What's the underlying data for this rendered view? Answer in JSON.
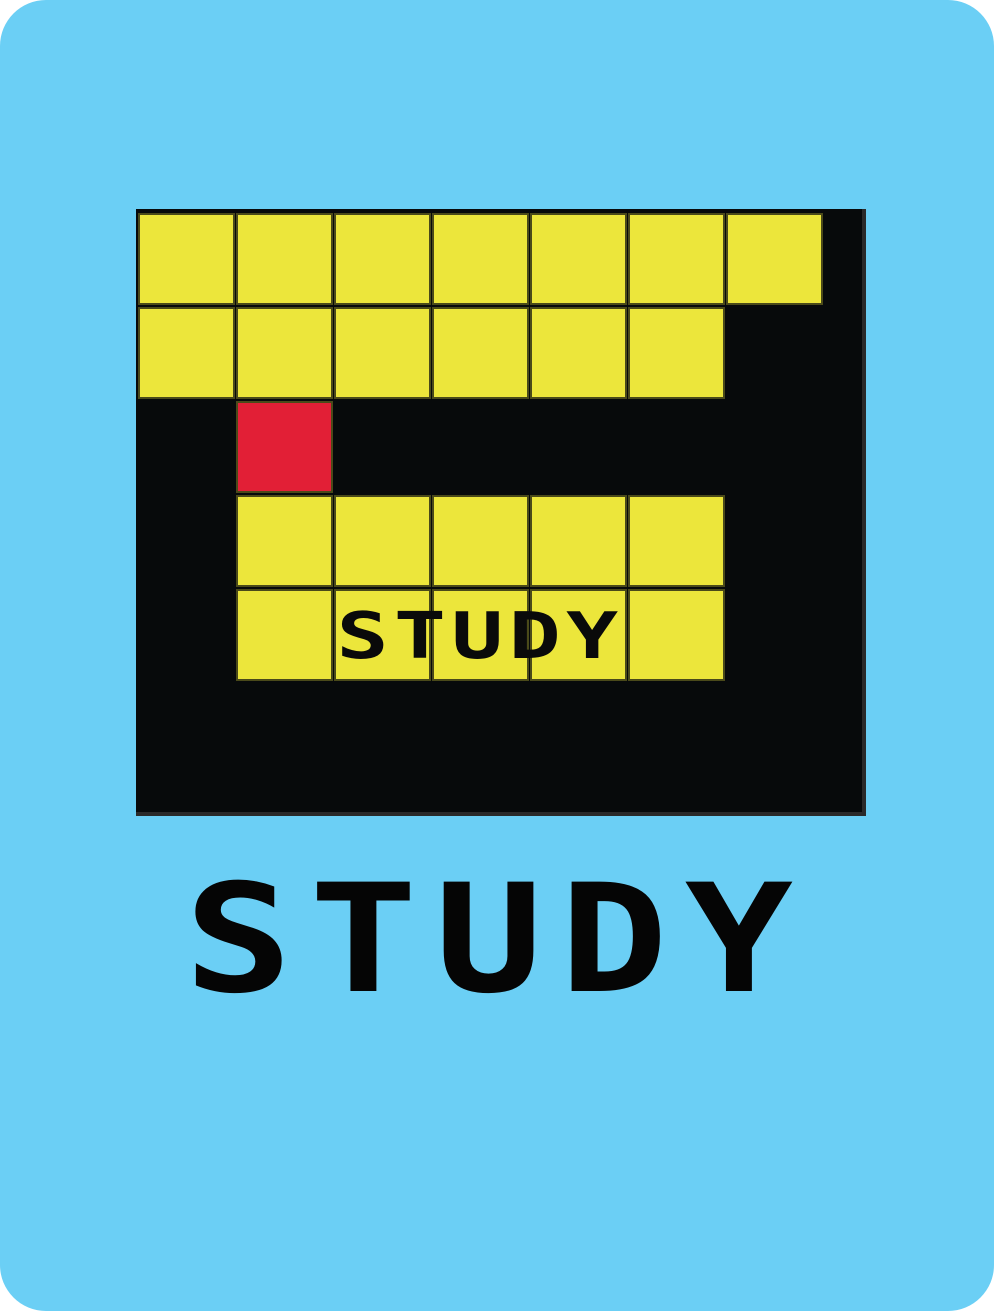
{
  "card": {
    "background": "#6bcff5",
    "title": "STUDY"
  },
  "grid": {
    "background": "#070a0b",
    "cell_color": "#ece63b",
    "highlight_color": "#e21f36",
    "label": "STUDY",
    "rows": [
      [
        "yellow",
        "yellow",
        "yellow",
        "yellow",
        "yellow",
        "yellow",
        "yellow"
      ],
      [
        "yellow",
        "yellow",
        "yellow",
        "yellow",
        "yellow",
        "yellow",
        "empty"
      ],
      [
        "empty",
        "red",
        "empty",
        "empty",
        "empty",
        "empty",
        "empty"
      ],
      [
        "empty",
        "yellow",
        "yellow",
        "yellow",
        "yellow",
        "yellow",
        "empty"
      ],
      [
        "empty",
        "yellow",
        "yellow",
        "yellow",
        "yellow",
        "yellow",
        "empty"
      ]
    ]
  }
}
